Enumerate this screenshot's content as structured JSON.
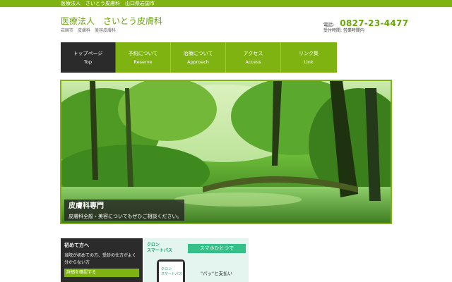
{
  "topbar": {
    "text": "医療法人　さいとう皮膚科　山口県岩国市"
  },
  "header": {
    "title": "医療法人　さいとう皮膚科",
    "subtitle": "岩国市　皮膚科　美容皮膚科",
    "phone_label": "電話:",
    "phone": "0827-23-4477",
    "hours": "受付時間: 営業時間内"
  },
  "nav": [
    {
      "label": "トップページ",
      "sub": "Top",
      "active": true
    },
    {
      "label": "予約について",
      "sub": "Reserve"
    },
    {
      "label": "治療について",
      "sub": "Approach"
    },
    {
      "label": "アクセス",
      "sub": "Access"
    },
    {
      "label": "リンク集",
      "sub": "Link"
    }
  ],
  "hero": {
    "title": "皮膚科専門",
    "text": "皮膚科全般・美容についてもぜひご相談ください。"
  },
  "first_visit": {
    "title": "初めて方へ",
    "text": "当院が初めての方、受診の仕方がよく分からない方",
    "button": "詳細を確認する"
  },
  "ad": {
    "logo_line1": "クロン",
    "logo_line2": "スマートパス",
    "headline": "スマホひとつで",
    "phone_line1": "クロン",
    "phone_line2": "スマートパス",
    "subtext": "\"パッ\"と支払い"
  },
  "colors": {
    "brand_green": "#7fb312",
    "dark": "#2b2b2b",
    "ad_green": "#35c08a"
  }
}
